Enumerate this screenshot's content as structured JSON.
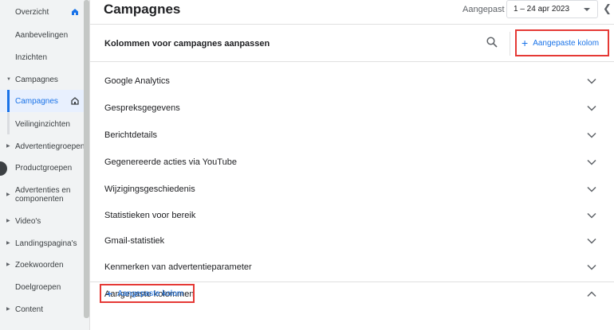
{
  "sidebar": {
    "items": [
      {
        "label": "Overzicht",
        "caret": false,
        "home": true
      },
      {
        "label": "Aanbevelingen",
        "caret": false
      },
      {
        "label": "Inzichten",
        "caret": false
      },
      {
        "label": "Campagnes",
        "caret": true,
        "expanded": true
      },
      {
        "label": "Campagnes",
        "caret": false,
        "active": true,
        "home": true
      },
      {
        "label": "Veilinginzichten",
        "caret": false
      },
      {
        "label": "Advertentiegroepen",
        "caret": true
      },
      {
        "label": "Productgroepen",
        "caret": false
      },
      {
        "label": "Advertenties en componenten",
        "caret": true
      },
      {
        "label": "Video's",
        "caret": true
      },
      {
        "label": "Landingspagina's",
        "caret": true
      },
      {
        "label": "Zoekwoorden",
        "caret": true
      },
      {
        "label": "Doelgroepen",
        "caret": false
      },
      {
        "label": "Content",
        "caret": true
      }
    ]
  },
  "header": {
    "title": "Campagnes",
    "date_label": "Aangepast",
    "date_range": "1 – 24 apr 2023"
  },
  "panel": {
    "title": "Kolommen voor campagnes aanpassen",
    "add_custom_column": "Aangepaste kolom",
    "sections": [
      {
        "label": "Google Analytics"
      },
      {
        "label": "Gespreksgegevens"
      },
      {
        "label": "Berichtdetails"
      },
      {
        "label": "Gegenereerde acties via YouTube"
      },
      {
        "label": "Wijzigingsgeschiedenis"
      },
      {
        "label": "Statistieken voor bereik"
      },
      {
        "label": "Gmail-statistiek"
      },
      {
        "label": "Kenmerken van advertentieparameter"
      },
      {
        "label": "Aangepaste kolommen",
        "expanded": true
      }
    ],
    "custom_add_label": "Aangepaste kolom"
  },
  "colors": {
    "accent": "#1a73e8",
    "highlight": "#e53935",
    "sidebar_bg": "#f1f3f4"
  }
}
